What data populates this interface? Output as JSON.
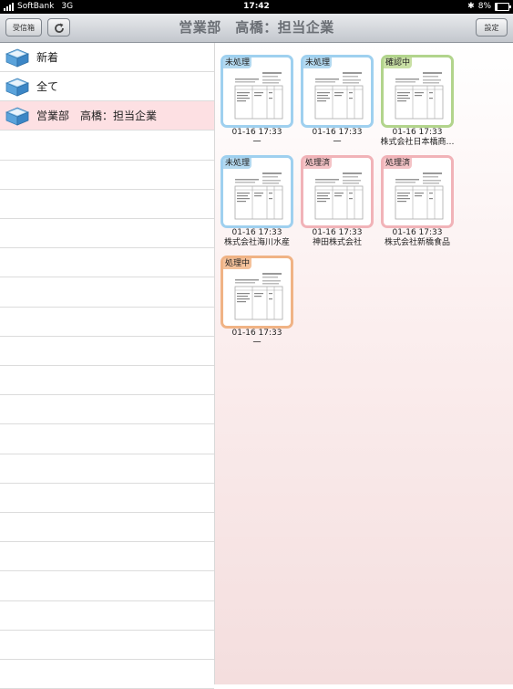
{
  "status_bar": {
    "carrier": "SoftBank",
    "network": "3G",
    "time": "17:42",
    "battery": "8%"
  },
  "nav": {
    "inbox_button": "受信箱",
    "title": "営業部　高橋：担当企業",
    "settings_button": "設定"
  },
  "sidebar": {
    "items": [
      {
        "label": "新着"
      },
      {
        "label": "全て"
      },
      {
        "label": "営業部　高橋：担当企業",
        "selected": true
      }
    ]
  },
  "documents": [
    {
      "status": "未処理",
      "status_color": "#b3d9f0",
      "border_color": "#9fd0ef",
      "date": "01-16 17:33",
      "company": "一"
    },
    {
      "status": "未処理",
      "status_color": "#b3d9f0",
      "border_color": "#9fd0ef",
      "date": "01-16 17:33",
      "company": "一"
    },
    {
      "status": "確認中",
      "status_color": "#c9e0a5",
      "border_color": "#b2d48c",
      "date": "01-16 17:33",
      "company": "株式会社日本橋商…"
    },
    {
      "status": "未処理",
      "status_color": "#b3d9f0",
      "border_color": "#9fd0ef",
      "date": "01-16 17:33",
      "company": "株式会社海川水産"
    },
    {
      "status": "処理済",
      "status_color": "#f4c3c6",
      "border_color": "#f1b3b8",
      "date": "01-16 17:33",
      "company": "神田株式会社"
    },
    {
      "status": "処理済",
      "status_color": "#f4c3c6",
      "border_color": "#f1b3b8",
      "date": "01-16 17:33",
      "company": "株式会社新橋食品"
    },
    {
      "status": "処理中",
      "status_color": "#f4c19a",
      "border_color": "#f0b385",
      "date": "01-16 17:33",
      "company": "一"
    }
  ]
}
